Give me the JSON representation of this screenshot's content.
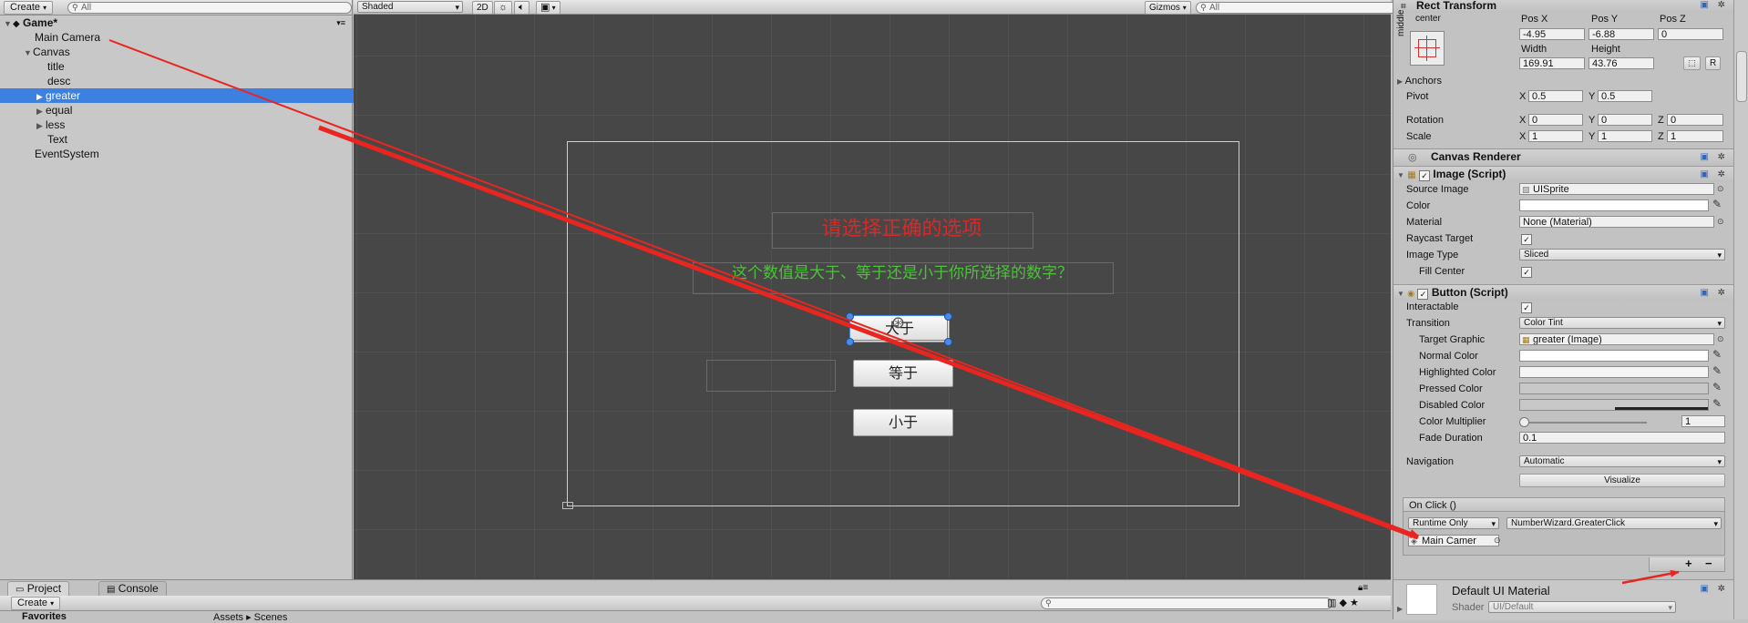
{
  "hierarchy": {
    "create_label": "Create",
    "search_placeholder": "All",
    "scene_name": "Game*",
    "items": [
      {
        "label": "Main Camera"
      },
      {
        "label": "Canvas"
      },
      {
        "label": "title"
      },
      {
        "label": "desc"
      },
      {
        "label": "greater"
      },
      {
        "label": "equal"
      },
      {
        "label": "less"
      },
      {
        "label": "Text"
      },
      {
        "label": "EventSystem"
      }
    ]
  },
  "scene": {
    "shading_mode": "Shaded",
    "mode_2d": "2D",
    "gizmos_label": "Gizmos",
    "search_placeholder": "All",
    "title_text": "请选择正确的选项",
    "title_color": "#d42a2a",
    "desc_text": "这个数值是大于、等于还是小于你所选择的数字？",
    "desc_color": "#4cc23a",
    "button_greater": "大于",
    "button_equal": "等于",
    "button_less": "小于"
  },
  "inspector": {
    "rect_transform": {
      "title": "Rect Transform",
      "anchor_h": "center",
      "anchor_v": "middle",
      "pos_x_label": "Pos X",
      "pos_x": "-4.95",
      "pos_y_label": "Pos Y",
      "pos_y": "-6.88",
      "pos_z_label": "Pos Z",
      "pos_z": "0",
      "width_label": "Width",
      "width": "169.91",
      "height_label": "Height",
      "height": "43.76",
      "r_button": "R",
      "anchors_label": "Anchors",
      "pivot_label": "Pivot",
      "pivot_x": "0.5",
      "pivot_y": "0.5",
      "rotation_label": "Rotation",
      "rot_x": "0",
      "rot_y": "0",
      "rot_z": "0",
      "scale_label": "Scale",
      "scale_x": "1",
      "scale_y": "1",
      "scale_z": "1"
    },
    "canvas_renderer": {
      "title": "Canvas Renderer"
    },
    "image": {
      "title": "Image (Script)",
      "source_image_label": "Source Image",
      "source_image": "UISprite",
      "color_label": "Color",
      "material_label": "Material",
      "material": "None (Material)",
      "raycast_label": "Raycast Target",
      "image_type_label": "Image Type",
      "image_type": "Sliced",
      "fill_center_label": "Fill Center"
    },
    "button": {
      "title": "Button (Script)",
      "interactable_label": "Interactable",
      "transition_label": "Transition",
      "transition": "Color Tint",
      "target_graphic_label": "Target Graphic",
      "target_graphic": "greater  (Image)",
      "normal_color_label": "Normal Color",
      "highlighted_color_label": "Highlighted Color",
      "pressed_color_label": "Pressed Color",
      "disabled_color_label": "Disabled Color",
      "color_multiplier_label": "Color Multiplier",
      "color_multiplier": "1",
      "fade_duration_label": "Fade Duration",
      "fade_duration": "0.1",
      "navigation_label": "Navigation",
      "navigation": "Automatic",
      "visualize_label": "Visualize",
      "onclick_label": "On Click ()",
      "runtime_label": "Runtime Only",
      "function_label": "NumberWizard.GreaterClick",
      "object_label": "Main Camer",
      "plus": "+",
      "minus": "−"
    },
    "material_footer": {
      "name": "Default UI Material",
      "shader_label": "Shader",
      "shader": "UI/Default"
    }
  },
  "bottom": {
    "tab_project": "Project",
    "tab_console": "Console",
    "create_label": "Create",
    "folder_fragment_left": "Favorites",
    "folder_fragment_right": "Assets ▸ Scenes"
  },
  "colors": {
    "selection": "#3d80df",
    "arrow": "#e8251f",
    "scene_bg": "#474747"
  }
}
